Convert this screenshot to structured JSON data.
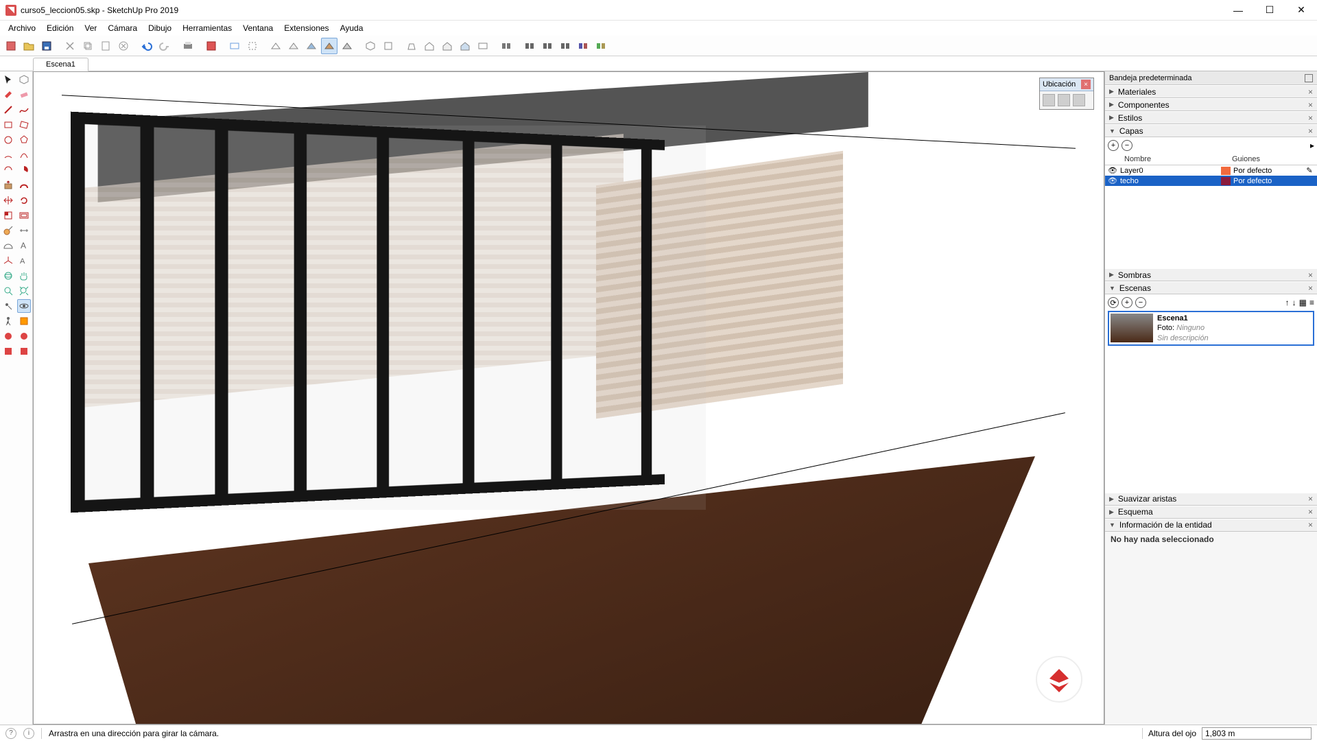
{
  "title": "curso5_leccion05.skp - SketchUp Pro 2019",
  "window_controls": {
    "min": "—",
    "max": "☐",
    "close": "✕"
  },
  "menu": [
    "Archivo",
    "Edición",
    "Ver",
    "Cámara",
    "Dibujo",
    "Herramientas",
    "Ventana",
    "Extensiones",
    "Ayuda"
  ],
  "scene_tab": "Escena1",
  "float_box": {
    "title": "Ubicación"
  },
  "tray": {
    "title": "Bandeja predeterminada",
    "panels": {
      "materiales": "Materiales",
      "componentes": "Componentes",
      "estilos": "Estilos",
      "capas": "Capas",
      "sombras": "Sombras",
      "escenas": "Escenas",
      "suavizar": "Suavizar aristas",
      "esquema": "Esquema",
      "info": "Información de la entidad"
    },
    "layers": {
      "col_name": "Nombre",
      "col_dash": "Guiones",
      "rows": [
        {
          "vis": "👁",
          "name": "Layer0",
          "color": "#f26a3d",
          "style": "Por defecto",
          "edit": "✎",
          "selected": false
        },
        {
          "vis": "👁",
          "name": "techo",
          "color": "#8a1b3d",
          "style": "Por defecto",
          "edit": "",
          "selected": true
        }
      ]
    },
    "scene_card": {
      "name": "Escena1",
      "photo_label": "Foto:",
      "photo_value": "Ninguno",
      "desc": "Sin descripción"
    },
    "entity_empty": "No hay nada seleccionado"
  },
  "status": {
    "hint": "Arrastra en una dirección para girar la cámara.",
    "eye_label": "Altura del ojo",
    "eye_value": "1,803 m"
  }
}
